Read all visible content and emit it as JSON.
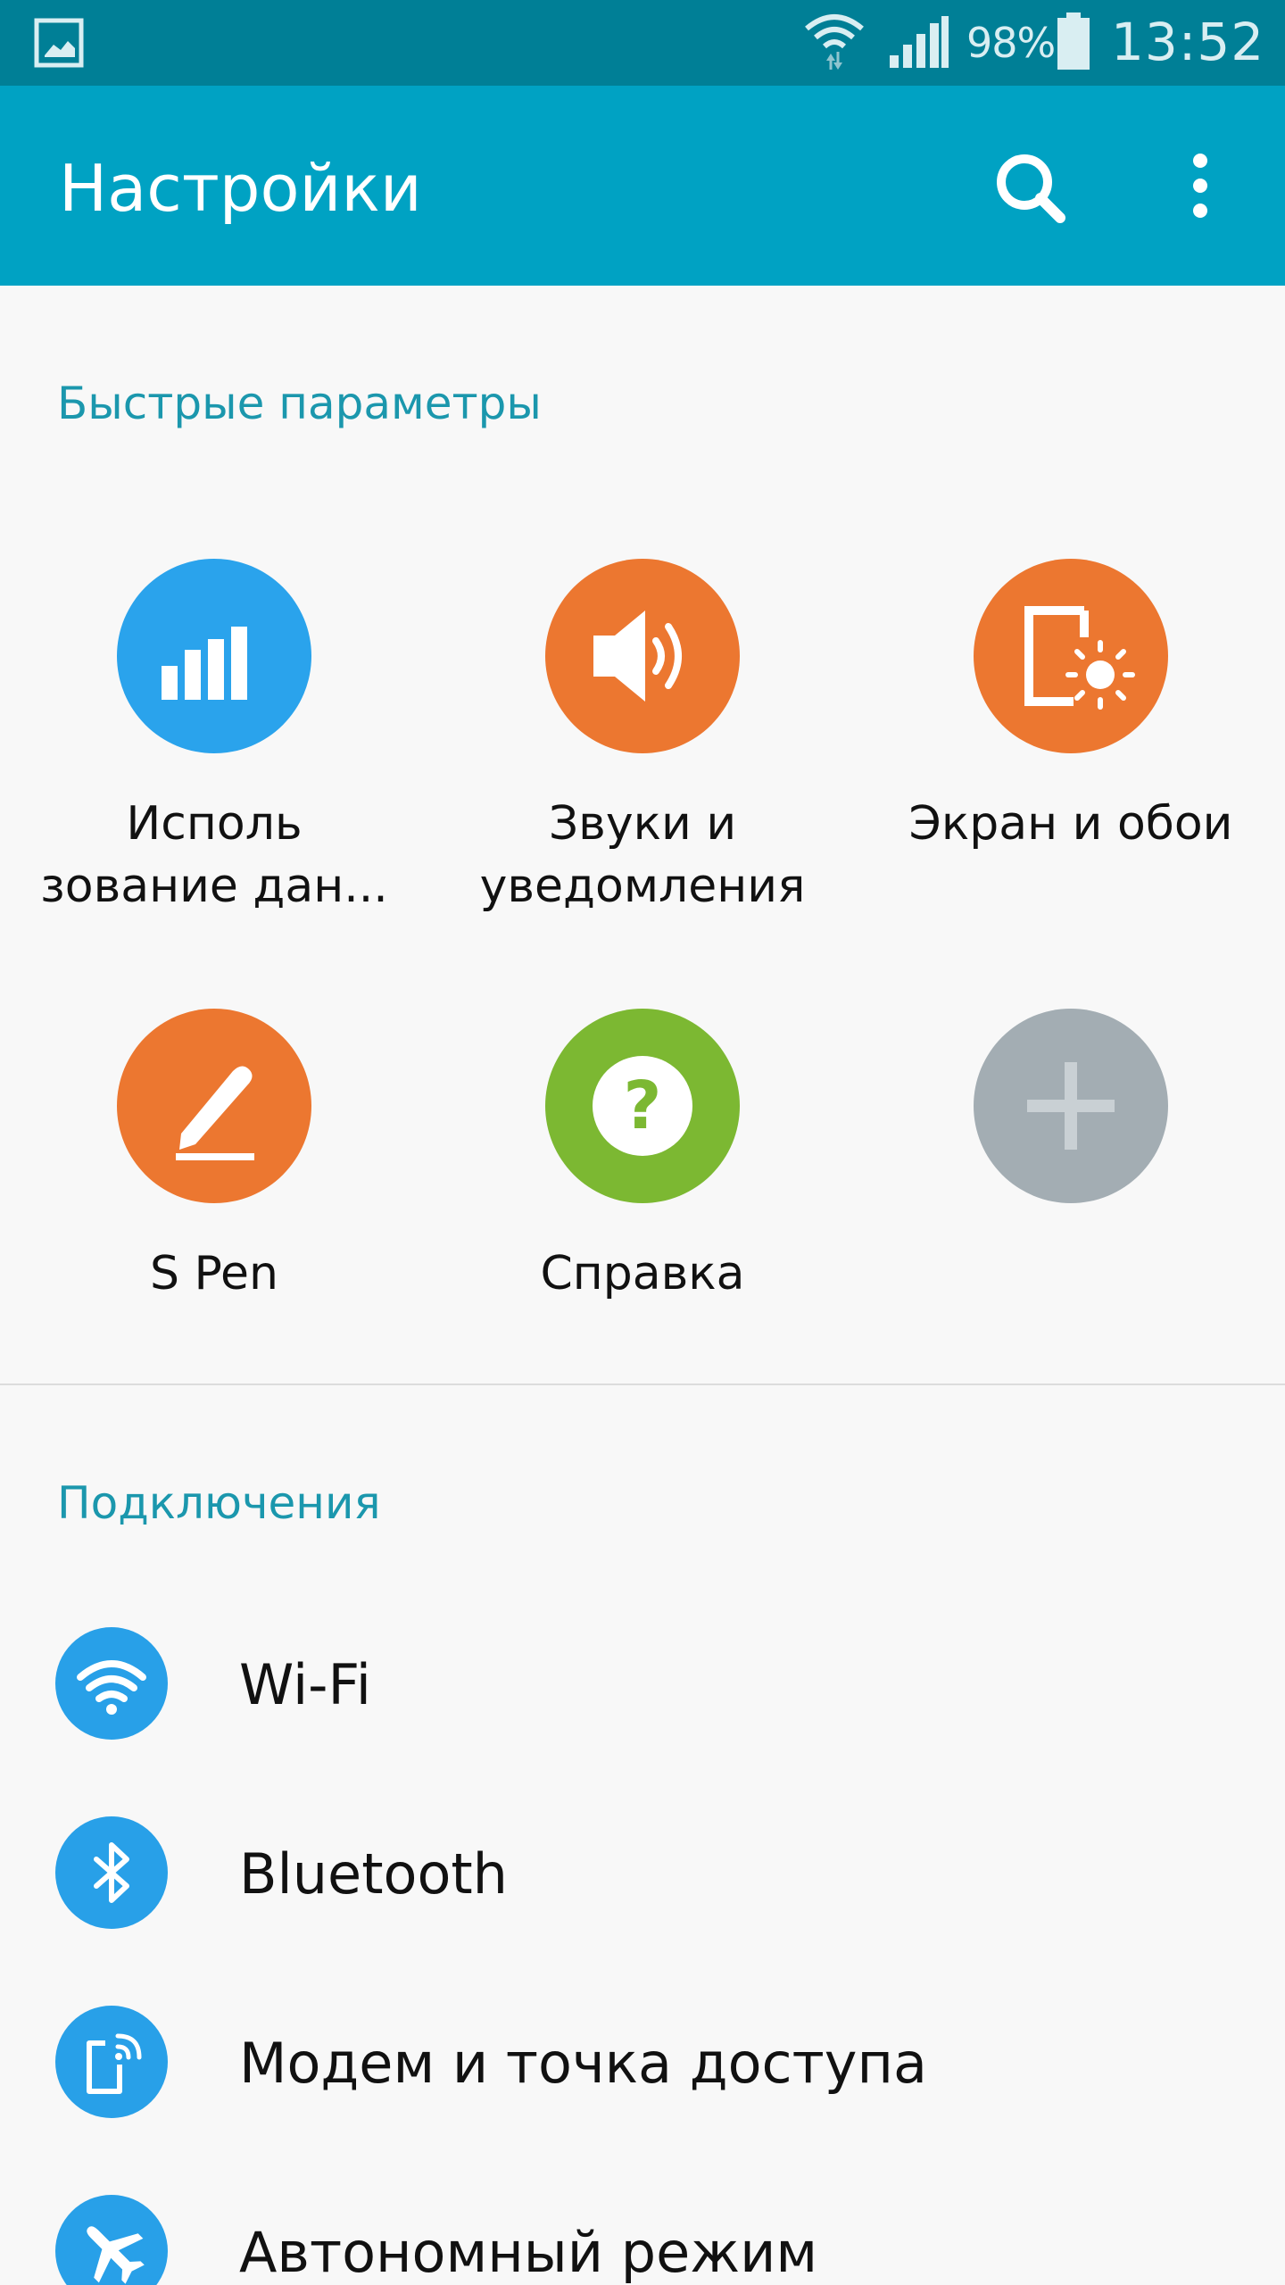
{
  "status_bar": {
    "battery_percent": "98%",
    "time": "13:52",
    "icons": [
      "gallery-icon",
      "wifi-icon",
      "signal-icon",
      "battery-icon"
    ]
  },
  "app_bar": {
    "title": "Настройки",
    "icons": [
      "search-icon",
      "more-vert-icon"
    ]
  },
  "quick_settings": {
    "header": "Быстрые параметры",
    "tiles": [
      {
        "label": "Исполь\nзование дан...",
        "icon": "data-usage-icon",
        "color": "#2aa3ec"
      },
      {
        "label": "Звуки и\nуведомления",
        "icon": "sound-icon",
        "color": "#ec7730"
      },
      {
        "label": "Экран и обои",
        "icon": "display-icon",
        "color": "#ec7730"
      },
      {
        "label": "S Pen",
        "icon": "s-pen-icon",
        "color": "#ec7730"
      },
      {
        "label": "Справка",
        "icon": "help-icon",
        "color": "#7cb832"
      },
      {
        "label": "",
        "icon": "add-icon",
        "color": "#a3adb3"
      }
    ]
  },
  "connections": {
    "header": "Подключения",
    "items": [
      {
        "label": "Wi-Fi",
        "icon": "wifi-icon"
      },
      {
        "label": "Bluetooth",
        "icon": "bluetooth-icon"
      },
      {
        "label": "Модем и точка доступа",
        "icon": "hotspot-icon"
      },
      {
        "label": "Автономный режим",
        "icon": "airplane-icon"
      }
    ]
  },
  "colors": {
    "status_bar": "#007f96",
    "app_bar": "#00a2c3",
    "section_header": "#1b97ad",
    "list_icon": "#28a0e8",
    "background": "#f8f8f8"
  }
}
